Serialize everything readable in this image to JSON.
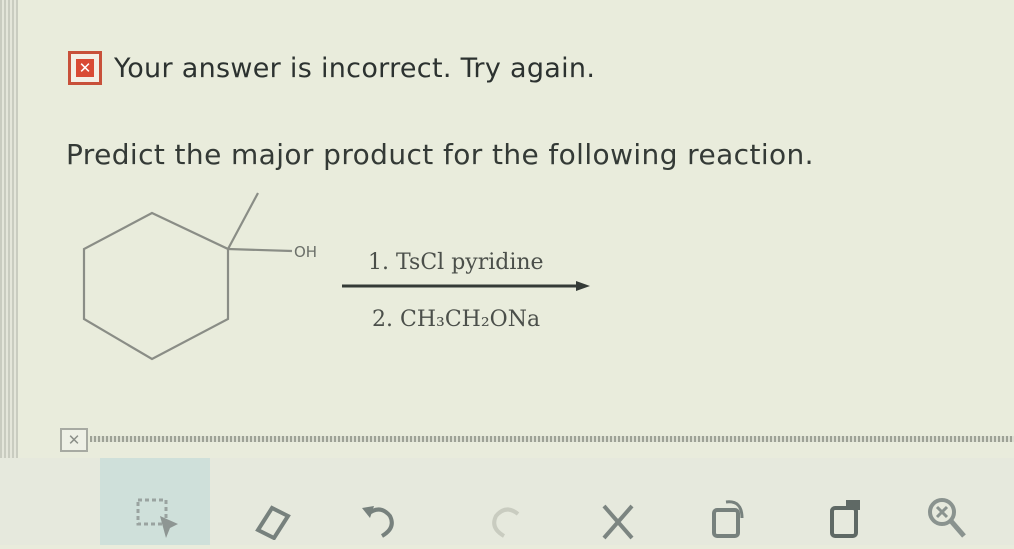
{
  "feedback": {
    "icon": "x-mark-icon",
    "message": "Your answer is incorrect.  Try again."
  },
  "question": {
    "prompt": "Predict the major product for the following reaction."
  },
  "reaction": {
    "substituent_label": "OH",
    "condition_1": "1. TsCl pyridine",
    "condition_2": "2. CH₃CH₂ONa"
  },
  "answer_area": {
    "close_icon": "x-mark-icon"
  },
  "toolbar": {
    "tools": [
      {
        "name": "select-tool",
        "icon": "arrow-select-icon"
      },
      {
        "name": "eraser-tool",
        "icon": "eraser-icon"
      },
      {
        "name": "undo-tool",
        "icon": "undo-icon"
      },
      {
        "name": "redo-tool",
        "icon": "redo-icon"
      },
      {
        "name": "clear-tool",
        "icon": "x-icon"
      },
      {
        "name": "copy-tool",
        "icon": "copy-icon"
      },
      {
        "name": "paste-tool",
        "icon": "paste-icon"
      },
      {
        "name": "zoom-tool",
        "icon": "zoom-icon"
      }
    ]
  },
  "colors": {
    "background": "#e9ecdc",
    "error_red": "#d94a35",
    "text": "#2c3230",
    "active_tool": "#cfe0da"
  }
}
